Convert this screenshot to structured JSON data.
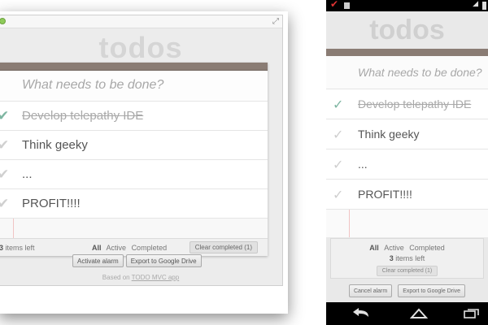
{
  "app": {
    "title": "todos",
    "new_todo_placeholder": "What needs to be done?",
    "todos": [
      {
        "text": "Develop telepathy IDE",
        "completed": true
      },
      {
        "text": "Think geeky",
        "completed": false
      },
      {
        "text": "...",
        "completed": false
      },
      {
        "text": "PROFIT!!!!",
        "completed": false
      }
    ],
    "items_left_count": "3",
    "items_left_label": "items left",
    "filters": {
      "all": "All",
      "active": "Active",
      "completed": "Completed",
      "selected": "All"
    },
    "clear_completed": "Clear completed (1)"
  },
  "desktop": {
    "activate_alarm": "Activate alarm",
    "export": "Export to Google Drive",
    "based_on_prefix": "Based on",
    "based_on_link": "TODO MVC app"
  },
  "phone": {
    "cancel_alarm": "Cancel alarm",
    "export": "Export to Google Drive"
  },
  "colors": {
    "header_strip": "#8a7c74",
    "check_done": "#7fb6a2",
    "margin_line": "#f1c4c4",
    "title_gray": "#d5d5d5"
  },
  "icons": {
    "status_left": "red-check-icon",
    "nav": [
      "back-icon",
      "home-icon",
      "recents-icon"
    ]
  }
}
